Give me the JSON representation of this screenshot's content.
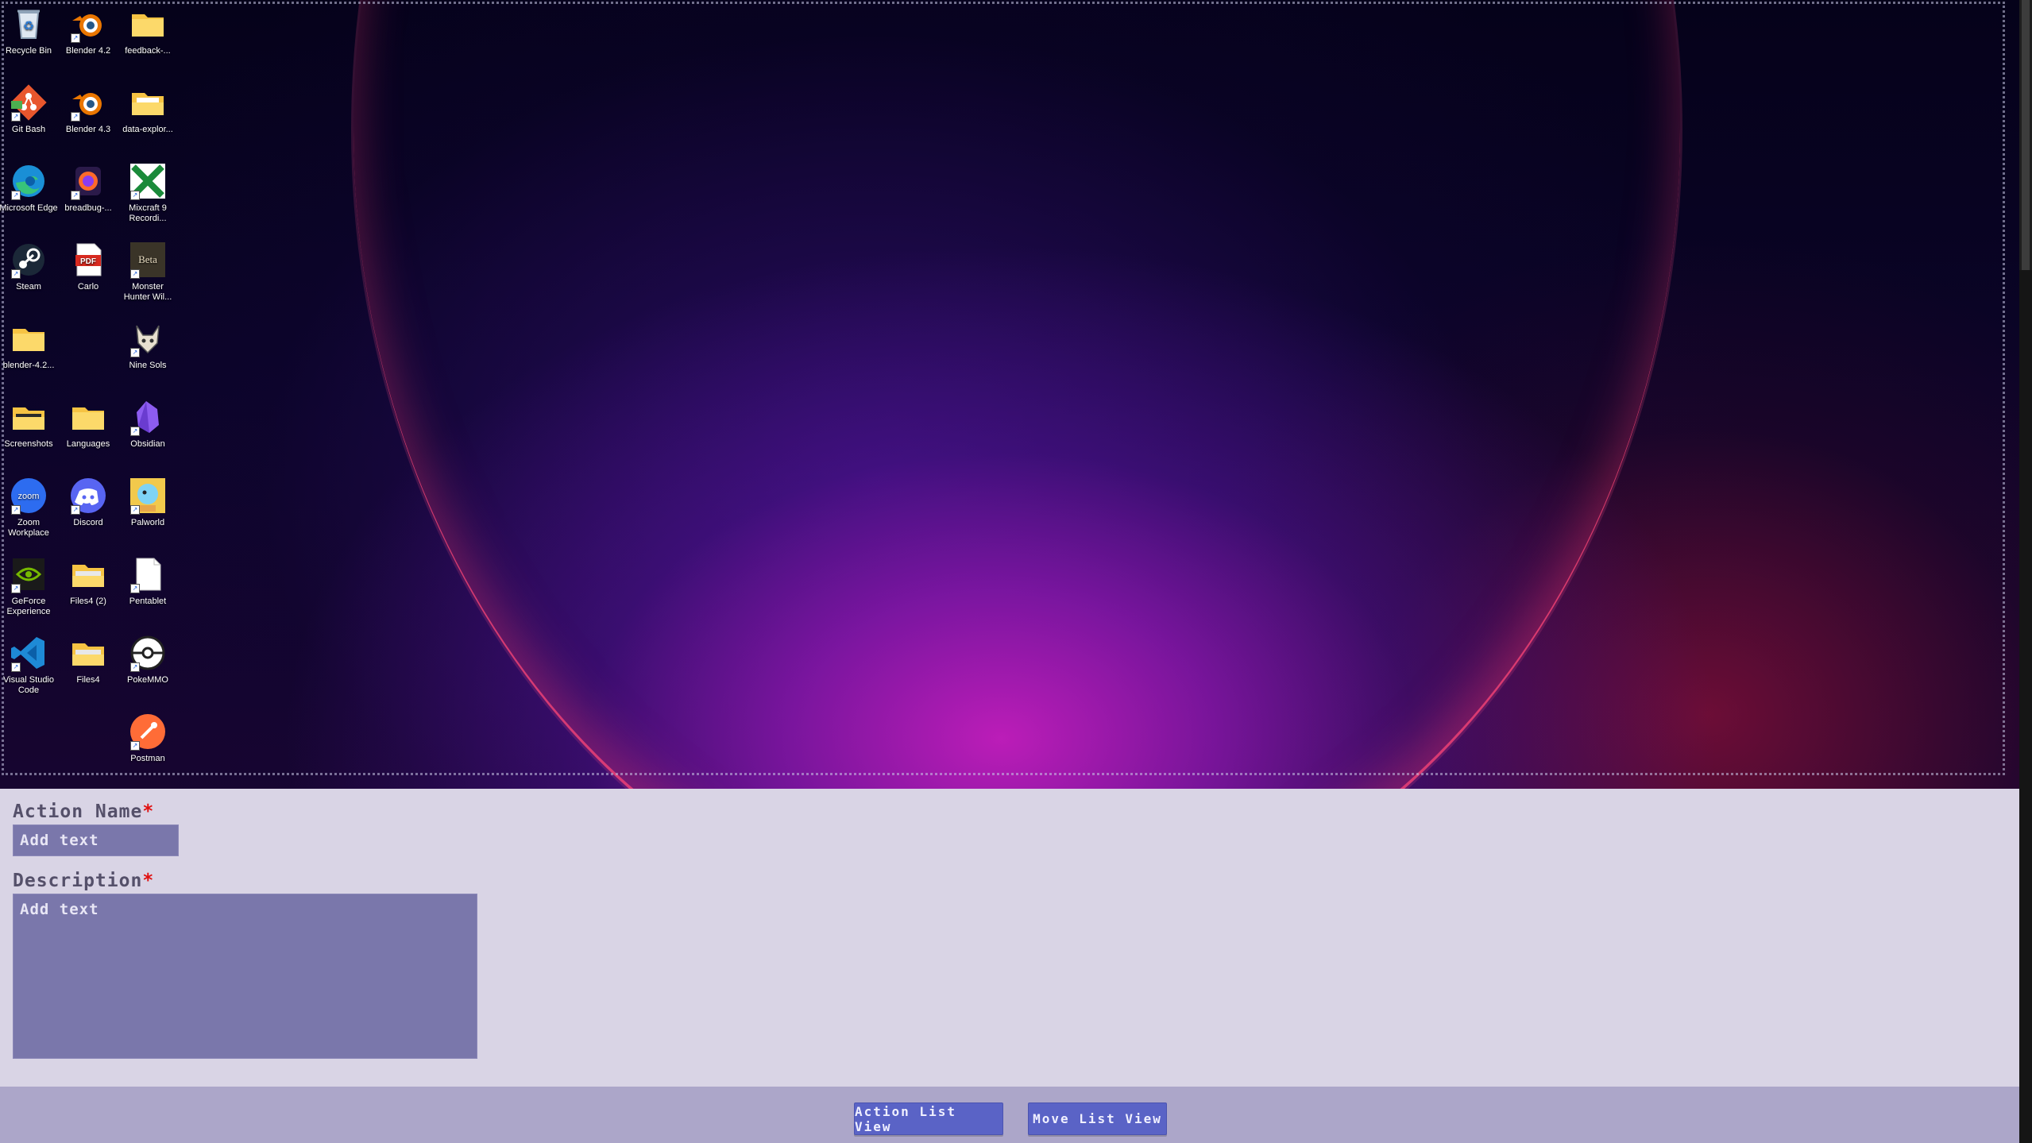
{
  "desktop": {
    "icons": [
      {
        "label": "Recycle Bin",
        "icon": "recycle-bin-icon",
        "shortcut": false
      },
      {
        "label": "Blender 4.2",
        "icon": "blender-icon",
        "shortcut": true
      },
      {
        "label": "feedback-...",
        "icon": "folder-icon",
        "shortcut": false
      },
      {
        "label": "Git Bash",
        "icon": "git-bash-icon",
        "shortcut": true
      },
      {
        "label": "Blender 4.3",
        "icon": "blender-icon",
        "shortcut": true
      },
      {
        "label": "data-explor...",
        "icon": "folder-icon",
        "shortcut": false
      },
      {
        "label": "Microsoft Edge",
        "icon": "edge-icon",
        "shortcut": true
      },
      {
        "label": "breadbug-...",
        "icon": "firefox-icon",
        "shortcut": true
      },
      {
        "label": "Mixcraft 9 Recordi...",
        "icon": "mixcraft-icon",
        "shortcut": true
      },
      {
        "label": "Steam",
        "icon": "steam-icon",
        "shortcut": true
      },
      {
        "label": "Carlo",
        "icon": "pdf-icon",
        "shortcut": false
      },
      {
        "label": "Monster Hunter Wil...",
        "icon": "monster-hunter-icon",
        "shortcut": true
      },
      {
        "label": "blender-4.2...",
        "icon": "folder-icon",
        "shortcut": false
      },
      {
        "label": "Nine Sols",
        "icon": "nine-sols-icon",
        "shortcut": true
      },
      {
        "label": "Screenshots",
        "icon": "folder-icon",
        "shortcut": false
      },
      {
        "label": "Languages",
        "icon": "folder-icon",
        "shortcut": false
      },
      {
        "label": "Obsidian",
        "icon": "obsidian-icon",
        "shortcut": true
      },
      {
        "label": "Zoom Workplace",
        "icon": "zoom-icon",
        "shortcut": true
      },
      {
        "label": "Discord",
        "icon": "discord-icon",
        "shortcut": true
      },
      {
        "label": "Palworld",
        "icon": "palworld-icon",
        "shortcut": true
      },
      {
        "label": "GeForce Experience",
        "icon": "geforce-icon",
        "shortcut": true
      },
      {
        "label": "Files4 (2)",
        "icon": "folder-icon",
        "shortcut": false
      },
      {
        "label": "Pentablet",
        "icon": "file-icon",
        "shortcut": true
      },
      {
        "label": "Visual Studio Code",
        "icon": "vscode-icon",
        "shortcut": true
      },
      {
        "label": "Files4",
        "icon": "folder-icon",
        "shortcut": false
      },
      {
        "label": "PokeMMO",
        "icon": "pokemmo-icon",
        "shortcut": true
      },
      {
        "label": "Postman",
        "icon": "postman-icon",
        "shortcut": true
      }
    ]
  },
  "form": {
    "action_name_label": "Action Name",
    "action_name_placeholder": "Add text",
    "description_label": "Description",
    "description_placeholder": "Add text",
    "required_mark": "*"
  },
  "footer": {
    "action_list_label": "Action List View",
    "move_list_label": "Move List View"
  },
  "colors": {
    "panel": "#d9d4e5",
    "input": "#7a77ab",
    "footer": "#aca6c9",
    "button": "#5a63c6",
    "required": "#e01010"
  }
}
